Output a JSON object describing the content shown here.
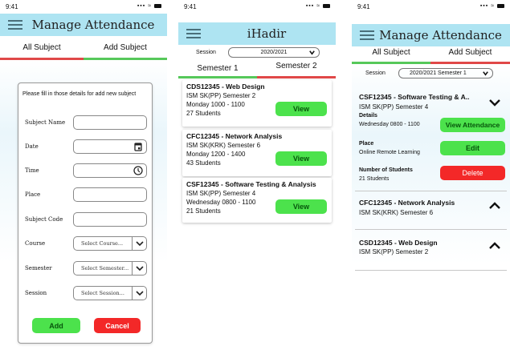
{
  "status_time": "9:41",
  "screen1": {
    "title": "Manage Attendance",
    "tabs": [
      "All Subject",
      "Add Subject"
    ],
    "form_intro": "Please fill in those details for add new subject",
    "fields": {
      "subject_name": "Subject Name",
      "date": "Date",
      "time": "Time",
      "place": "Place",
      "subject_code": "Subject Code",
      "course": "Course",
      "semester": "Semester",
      "session": "Session"
    },
    "selects": {
      "course": "Select Course...",
      "semester": "Select Semester...",
      "session": "Select Session..."
    },
    "add_label": "Add",
    "cancel_label": "Cancel"
  },
  "screen2": {
    "title": "iHadir",
    "session_label": "Session",
    "session_value": "2020/2021",
    "tabs": [
      "Semester 1",
      "Semester 2"
    ],
    "courses": [
      {
        "code": "CDS12345 - Web Design",
        "program": "ISM SK(PP) Semester 2",
        "schedule": "Monday 1000 - 1100",
        "students": "27 Students",
        "button": "View"
      },
      {
        "code": "CFC12345 - Network Analysis",
        "program": "ISM SK(KRK) Semester 6",
        "schedule": "Monday 1200 - 1400",
        "students": "43 Students",
        "button": "View"
      },
      {
        "code": "CSF12345 - Software Testing & Analysis",
        "program": "ISM SK(PP) Semester 4",
        "schedule": "Wednesday 0800 - 1100",
        "students": "21 Students",
        "button": "View"
      }
    ]
  },
  "screen3": {
    "title": "Manage Attendance",
    "tabs": [
      "All Subject",
      "Add Subject"
    ],
    "session_label": "Session",
    "session_value": "2020/2021 Semester 1",
    "expanded": {
      "title": "CSF12345 - Software Testing & A..",
      "program": "ISM SK(PP) Semester 4",
      "details_label": "Details",
      "details_value": "Wednesday 0800 - 1100",
      "place_label": "Place",
      "place_value": "Online Remote Learning",
      "students_label": "Number of Students",
      "students_value": "21 Students",
      "view_attendance": "View Attendance",
      "edit": "Edit",
      "delete": "Delete"
    },
    "collapsed": [
      {
        "title": "CFC12345 - Network Analysis",
        "program": "ISM SK(KRK) Semester 6"
      },
      {
        "title": "CSD12345 - Web Design",
        "program": "ISM SK(PP) Semester 2"
      }
    ]
  },
  "colors": {
    "header": "#aee4f2",
    "green": "#4ce24c",
    "red": "#f32828",
    "tab_red": "#e04848",
    "tab_green": "#56c85a"
  }
}
